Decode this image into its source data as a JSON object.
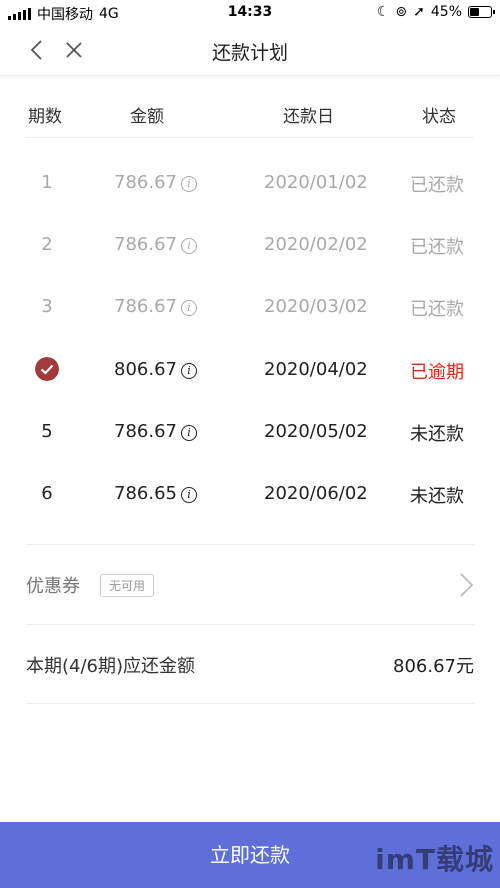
{
  "status_bar": {
    "carrier": "中国移动",
    "network": "4G",
    "time": "14:33",
    "battery": "45%",
    "battery_level": 0.45
  },
  "nav": {
    "title": "还款计划",
    "back_icon": "chevron-left-icon",
    "close_icon": "close-icon"
  },
  "table": {
    "headers": [
      "期数",
      "金额",
      "还款日",
      "状态"
    ],
    "rows": [
      {
        "period": "1",
        "amount": "786.67",
        "date": "2020/01/02",
        "status": "已还款"
      },
      {
        "period": "2",
        "amount": "786.67",
        "date": "2020/02/02",
        "status": "已还款"
      },
      {
        "period": "3",
        "amount": "786.67",
        "date": "2020/03/02",
        "status": "已还款"
      },
      {
        "period": "",
        "amount": "806.67",
        "date": "2020/04/02",
        "status": "已逾期"
      },
      {
        "period": "5",
        "amount": "786.67",
        "date": "2020/05/02",
        "status": "未还款"
      },
      {
        "period": "6",
        "amount": "786.65",
        "date": "2020/06/02",
        "status": "未还款"
      }
    ]
  },
  "coupon": {
    "label": "优惠券",
    "badge": "无可用"
  },
  "due": {
    "label": "本期(4/6期)应还金额",
    "value": "806.67元"
  },
  "pay_button": "立即还款",
  "watermark": "imT载城",
  "colors": {
    "accent": "#5f6fd9",
    "overdue": "#e0271a",
    "check": "#a33a3a",
    "paid_text": "#a9a9a9"
  }
}
